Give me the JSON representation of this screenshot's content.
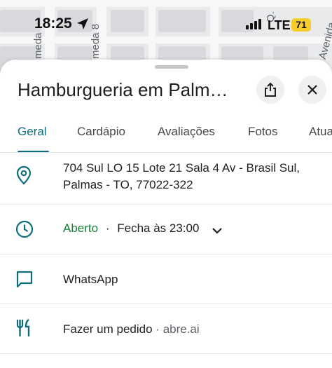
{
  "status_bar": {
    "time": "18:25",
    "network": "LTE",
    "battery": "71"
  },
  "map": {
    "street_labels": [
      "meda",
      "meda 8",
      "Q.",
      "Avenida"
    ]
  },
  "place": {
    "title": "Hamburgueria em Palm…",
    "share_icon": "share-icon",
    "close_icon": "close-icon"
  },
  "tabs": [
    {
      "label": "Geral",
      "active": true
    },
    {
      "label": "Cardápio",
      "active": false
    },
    {
      "label": "Avaliações",
      "active": false
    },
    {
      "label": "Fotos",
      "active": false
    },
    {
      "label": "Atua",
      "active": false
    }
  ],
  "details": {
    "address_line1": "704 Sul LO 15 Lote 21 Sala 4 Av - Brasil Sul,",
    "address_line2": "Palmas - TO, 77022-322",
    "hours_status": "Aberto",
    "hours_separator": "·",
    "hours_text": "Fecha às 23:00",
    "whatsapp": "WhatsApp",
    "order_label": "Fazer um pedido",
    "order_separator": " · ",
    "order_site": "abre.ai"
  },
  "colors": {
    "accent": "#0b6e7a",
    "open": "#188038",
    "battery": "#f5cd2f"
  }
}
